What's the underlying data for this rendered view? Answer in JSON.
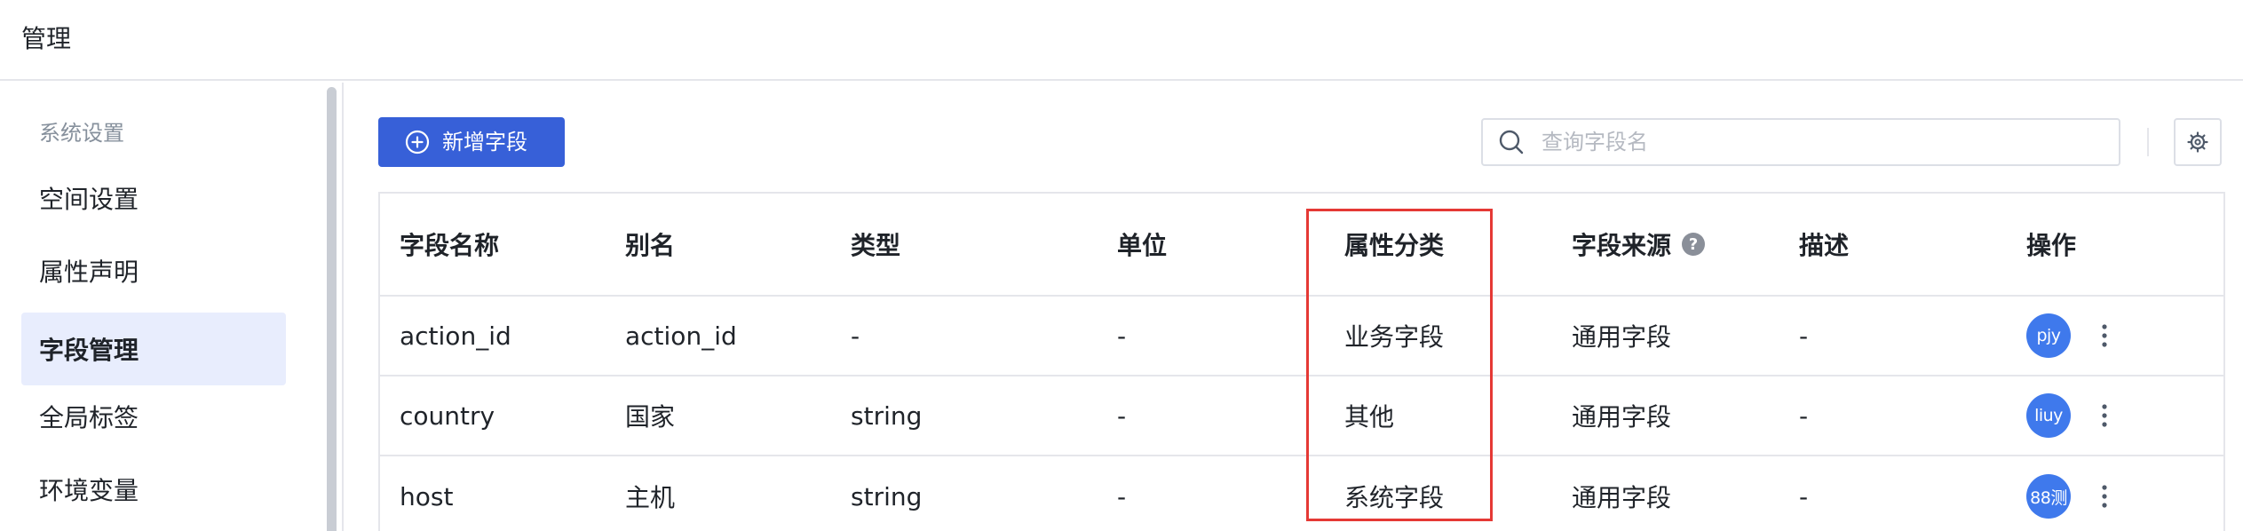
{
  "header": {
    "title": "管理"
  },
  "sidebar": {
    "group_label": "系统设置",
    "items": [
      {
        "label": "空间设置",
        "active": false
      },
      {
        "label": "属性声明",
        "active": false
      },
      {
        "label": "字段管理",
        "active": true
      },
      {
        "label": "全局标签",
        "active": false
      },
      {
        "label": "环境变量",
        "active": false
      }
    ]
  },
  "toolbar": {
    "add_label": "新增字段",
    "search_placeholder": "查询字段名"
  },
  "table": {
    "columns": [
      "字段名称",
      "别名",
      "类型",
      "单位",
      "属性分类",
      "字段来源",
      "描述",
      "操作"
    ],
    "rows": [
      {
        "name": "action_id",
        "alias": "action_id",
        "type": "-",
        "unit": "-",
        "category": "业务字段",
        "source": "通用字段",
        "desc": "-",
        "avatar": "pjy"
      },
      {
        "name": "country",
        "alias": "国家",
        "type": "string",
        "unit": "-",
        "category": "其他",
        "source": "通用字段",
        "desc": "-",
        "avatar": "liuy"
      },
      {
        "name": "host",
        "alias": "主机",
        "type": "string",
        "unit": "-",
        "category": "系统字段",
        "source": "通用字段",
        "desc": "-",
        "avatar": "88测"
      }
    ]
  },
  "colors": {
    "primary": "#3760d8",
    "active_bg": "#e8edfd",
    "avatar": "#3f79ec",
    "highlight": "#e53935"
  }
}
